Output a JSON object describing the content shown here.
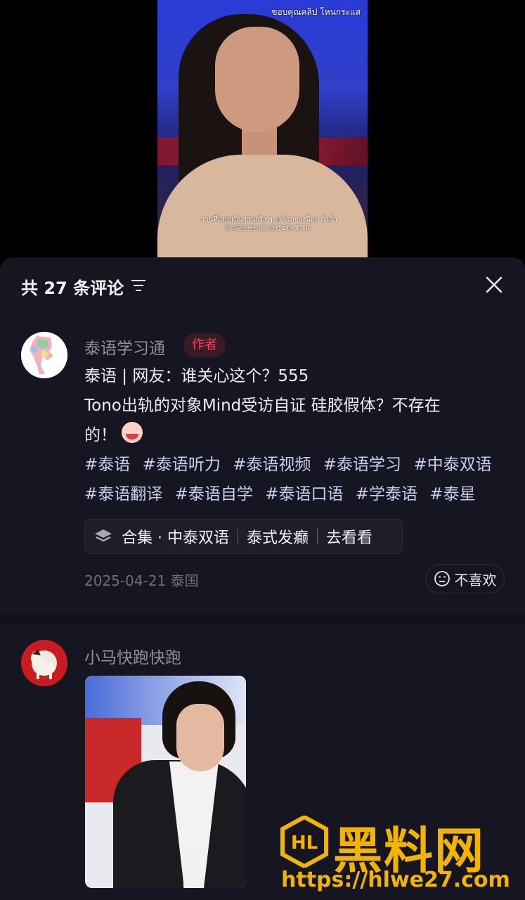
{
  "video": {
    "watermark_top": "ขอบคุณคลิป โหนกระแส",
    "subtitle_thai": "งานที่แบบเป็นงานจริง ๆ อะไรอย่างนี้อะ ถ้าก้า",
    "subtitle_chinese": "指的是正当合法的正经工作 像那种"
  },
  "comments_sheet": {
    "title": "共 27 条评论",
    "filter_icon": "filter-lines-icon",
    "close_icon": "close-x-icon"
  },
  "comments": [
    {
      "username": "泰语学习通",
      "badge": "作者",
      "lines": [
        "泰语 | 网友：谁关心这个？555",
        "Tono出轨的对象Mind受访自证 硅胶假体？不存在",
        "的！"
      ],
      "hashtags": [
        "#泰语",
        "#泰语听力",
        "#泰语视频",
        "#泰语学习",
        "#中泰双语",
        "#泰语翻译",
        "#泰语自学",
        "#泰语口语",
        "#学泰语",
        "#泰星"
      ],
      "collection": {
        "label": "合集 · 中泰双语",
        "name": "泰式发癫",
        "action": "去看看"
      },
      "date_location": "2025-04-21 泰国",
      "dislike_label": "不喜欢"
    },
    {
      "username": "小马快跑快跑"
    }
  ],
  "site_watermark": {
    "name": "黑料网",
    "url": "https://hlwe27.com"
  },
  "colors": {
    "sheet_bg": "#161622",
    "accent_badge": "#ff3d63",
    "hashtag": "#c9cdf0",
    "watermark": "#f2b400"
  }
}
